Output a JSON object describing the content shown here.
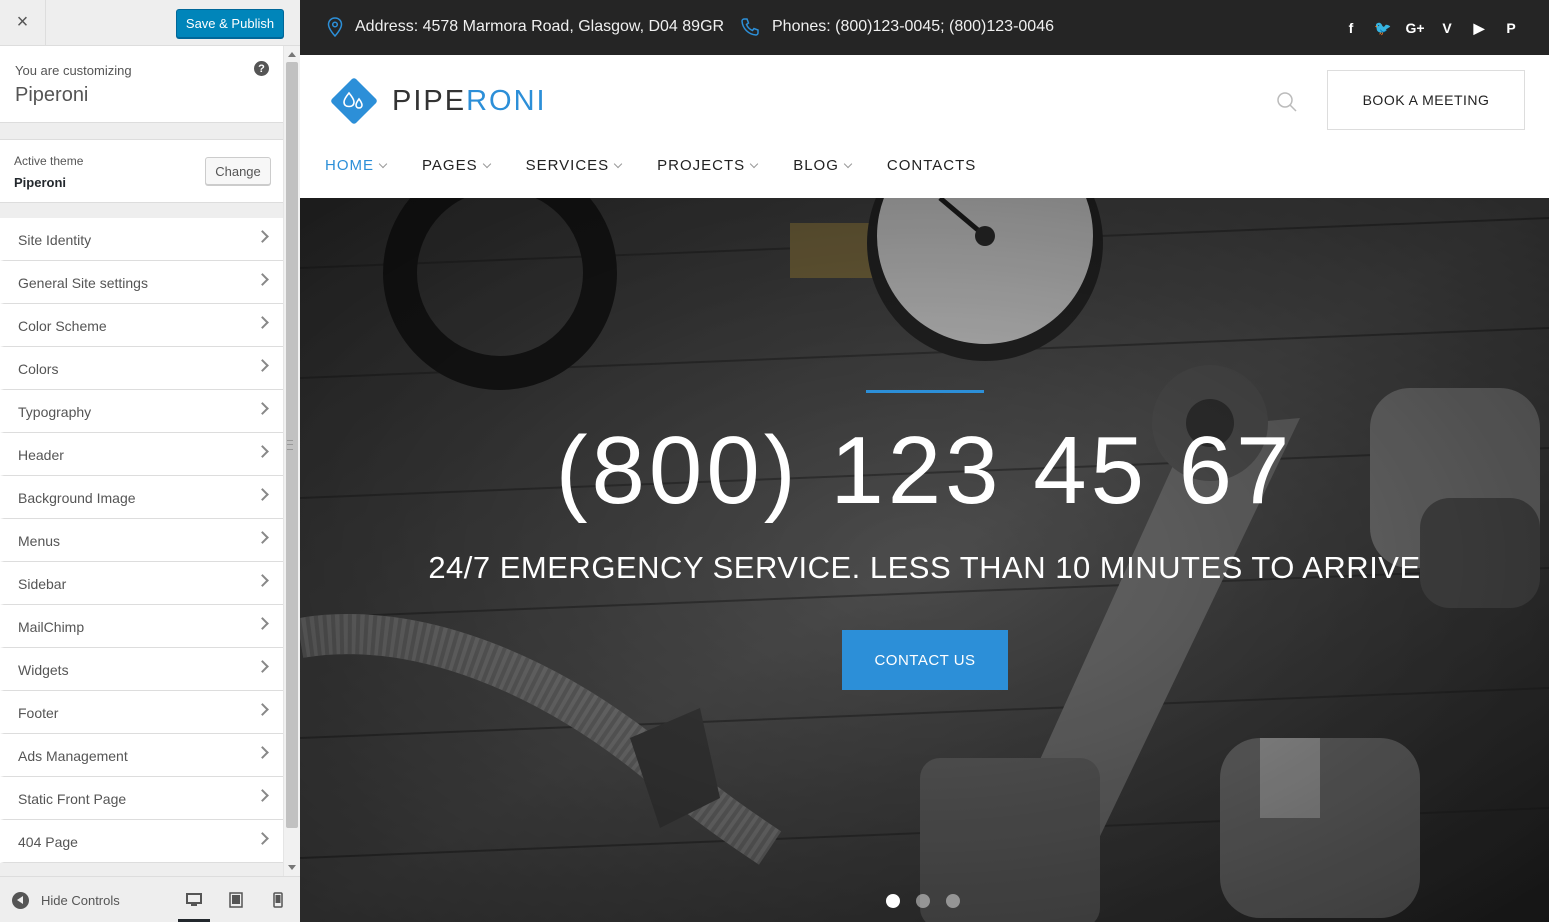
{
  "customizer": {
    "close_label": "×",
    "save_label": "Save & Publish",
    "customizing_label": "You are customizing",
    "site_name": "Piperoni",
    "help_label": "?",
    "active_theme_label": "Active theme",
    "active_theme_name": "Piperoni",
    "change_label": "Change",
    "sections": [
      {
        "label": "Site Identity"
      },
      {
        "label": "General Site settings"
      },
      {
        "label": "Color Scheme"
      },
      {
        "label": "Colors"
      },
      {
        "label": "Typography"
      },
      {
        "label": "Header"
      },
      {
        "label": "Background Image"
      },
      {
        "label": "Menus"
      },
      {
        "label": "Sidebar"
      },
      {
        "label": "MailChimp"
      },
      {
        "label": "Widgets"
      },
      {
        "label": "Footer"
      },
      {
        "label": "Ads Management"
      },
      {
        "label": "Static Front Page"
      },
      {
        "label": "404 Page"
      }
    ],
    "hide_controls_label": "Hide Controls",
    "devices": [
      "desktop-icon",
      "tablet-icon",
      "mobile-icon"
    ],
    "active_device": "desktop"
  },
  "site": {
    "topbar": {
      "address": "Address: 4578 Marmora Road, Glasgow, D04 89GR",
      "phones": "Phones: (800)123-0045; (800)123-0046",
      "socials": [
        {
          "icon": "facebook-icon",
          "glyph": "f"
        },
        {
          "icon": "twitter-icon",
          "glyph": "🐦"
        },
        {
          "icon": "google-plus-icon",
          "glyph": "G+"
        },
        {
          "icon": "vimeo-icon",
          "glyph": "V"
        },
        {
          "icon": "youtube-icon",
          "glyph": "▶"
        },
        {
          "icon": "pinterest-icon",
          "glyph": "P"
        }
      ]
    },
    "logo": {
      "part1": "PIPE",
      "part2": "RONI"
    },
    "book_label": "BOOK A MEETING",
    "nav": [
      {
        "label": "HOME",
        "dropdown": true,
        "active": true
      },
      {
        "label": "PAGES",
        "dropdown": true
      },
      {
        "label": "SERVICES",
        "dropdown": true
      },
      {
        "label": "PROJECTS",
        "dropdown": true
      },
      {
        "label": "BLOG",
        "dropdown": true
      },
      {
        "label": "CONTACTS",
        "dropdown": false
      }
    ],
    "hero": {
      "phone": "(800) 123 45 67",
      "subtitle": "24/7 EMERGENCY SERVICE. LESS THAN 10 MINUTES TO ARRIVE",
      "button_label": "CONTACT US",
      "slides": 3,
      "active_slide": 0
    },
    "colors": {
      "accent": "#2c8fd8",
      "topbar": "#252525",
      "wp_button": "#0085ba"
    }
  }
}
